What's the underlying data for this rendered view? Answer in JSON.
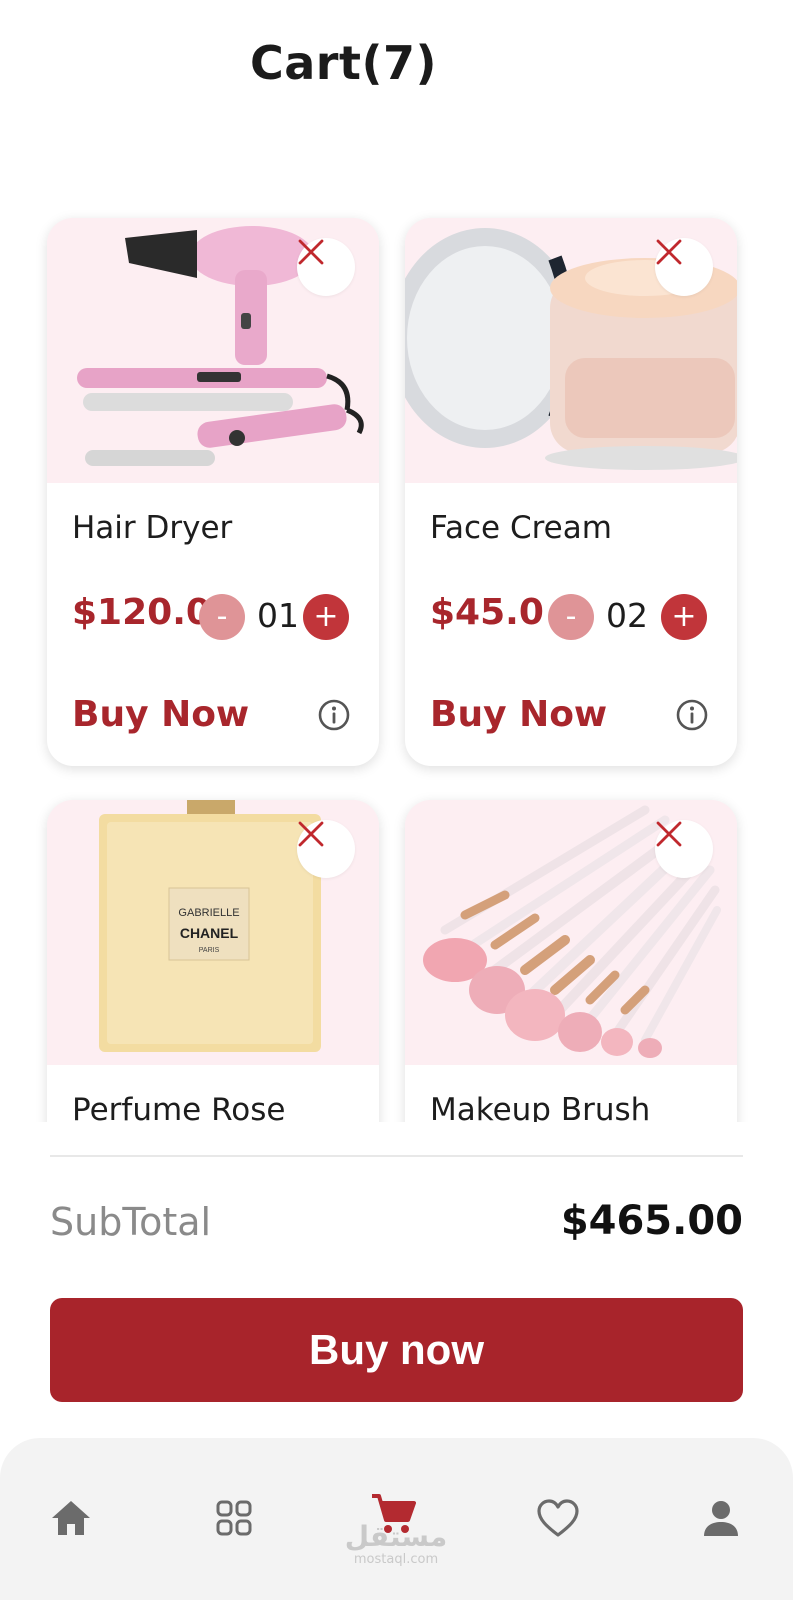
{
  "header": {
    "title": "Cart(7)"
  },
  "products": [
    {
      "name": "Hair Dryer",
      "price": "$120.0",
      "qty": "01",
      "minus": "-",
      "plus": "+",
      "buy_label": "Buy Now",
      "image": "hair-styling-set-image"
    },
    {
      "name": "Face Cream",
      "price": "$45.0",
      "qty": "02",
      "minus": "-",
      "plus": "+",
      "buy_label": "Buy Now",
      "image": "face-cream-jar-image"
    },
    {
      "name": "Perfume Rose",
      "price": "",
      "qty": "",
      "buy_label": "",
      "image": "perfume-bottle-image",
      "image_text": [
        "GABRIELLE",
        "CHANEL",
        "PARIS"
      ]
    },
    {
      "name": "Makeup Brush",
      "price": "",
      "qty": "",
      "buy_label": "",
      "image": "makeup-brushes-image"
    }
  ],
  "summary": {
    "subtotal_label": "SubTotal",
    "subtotal_value": "$465.00"
  },
  "checkout": {
    "button_label": "Buy now"
  },
  "bottom_nav": {
    "items": [
      "home-icon",
      "grid-icon",
      "cart-icon",
      "heart-icon",
      "person-icon"
    ],
    "active": "cart-icon"
  },
  "watermark": {
    "arabic": "مستقل",
    "latin": "mostaql.com"
  },
  "colors": {
    "accent": "#a8262c",
    "minus_button": "#df9497",
    "plus_button": "#c1353a",
    "card_image_bg": "#fdeef2",
    "nav_bg": "#f3f3f3"
  }
}
